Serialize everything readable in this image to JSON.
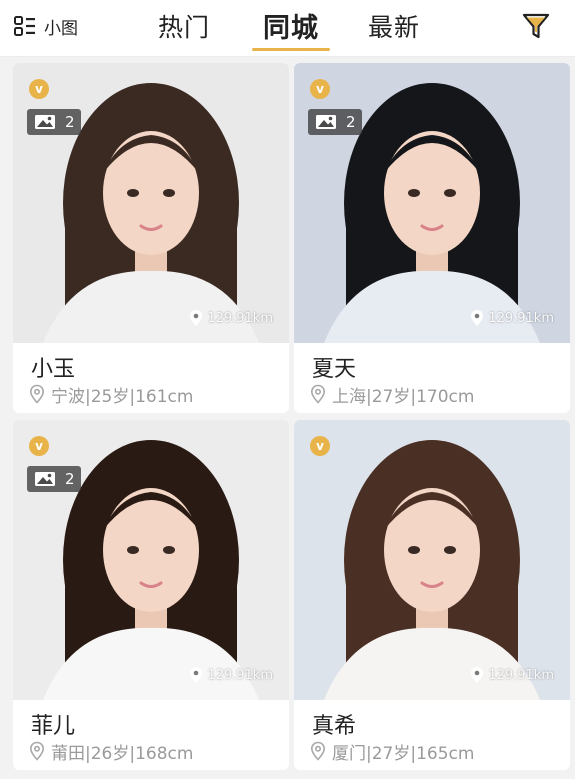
{
  "header": {
    "view_toggle_label": "小图",
    "tabs": [
      {
        "label": "热门",
        "active": false
      },
      {
        "label": "同城",
        "active": true
      },
      {
        "label": "最新",
        "active": false
      }
    ],
    "accent_color": "#e8b44a"
  },
  "profiles": [
    {
      "name": "小玉",
      "details": "宁波|25岁|161cm",
      "photo_count": "2",
      "distance": "129.91km",
      "vip_mark": "v",
      "photo_bg": "#e9e9ea",
      "hair": "#3b2a22",
      "top": "#f1f1f1"
    },
    {
      "name": "夏天",
      "details": "上海|27岁|170cm",
      "photo_count": "2",
      "distance": "129.91km",
      "vip_mark": "v",
      "photo_bg": "#cfd6e2",
      "hair": "#15161a",
      "top": "#e7ebf2"
    },
    {
      "name": "菲儿",
      "details": "莆田|26岁|168cm",
      "photo_count": "2",
      "distance": "129.91km",
      "vip_mark": "v",
      "photo_bg": "#ececec",
      "hair": "#2a1a14",
      "top": "#f7f7f7"
    },
    {
      "name": "真希",
      "details": "厦门|27岁|165cm",
      "photo_count": "",
      "distance": "129.91km",
      "vip_mark": "v",
      "photo_bg": "#dde3ea",
      "hair": "#4a2f24",
      "top": "#f5f4f2"
    }
  ],
  "icons": {
    "view_toggle": "grid-list-icon",
    "filter": "funnel-icon",
    "photo": "image-icon",
    "distance": "location-pin-icon",
    "location": "location-outline-icon",
    "vip": "vip-badge-icon"
  },
  "colors": {
    "vip_badge": "#e8b44a",
    "meta_text": "#9a9a9a"
  }
}
